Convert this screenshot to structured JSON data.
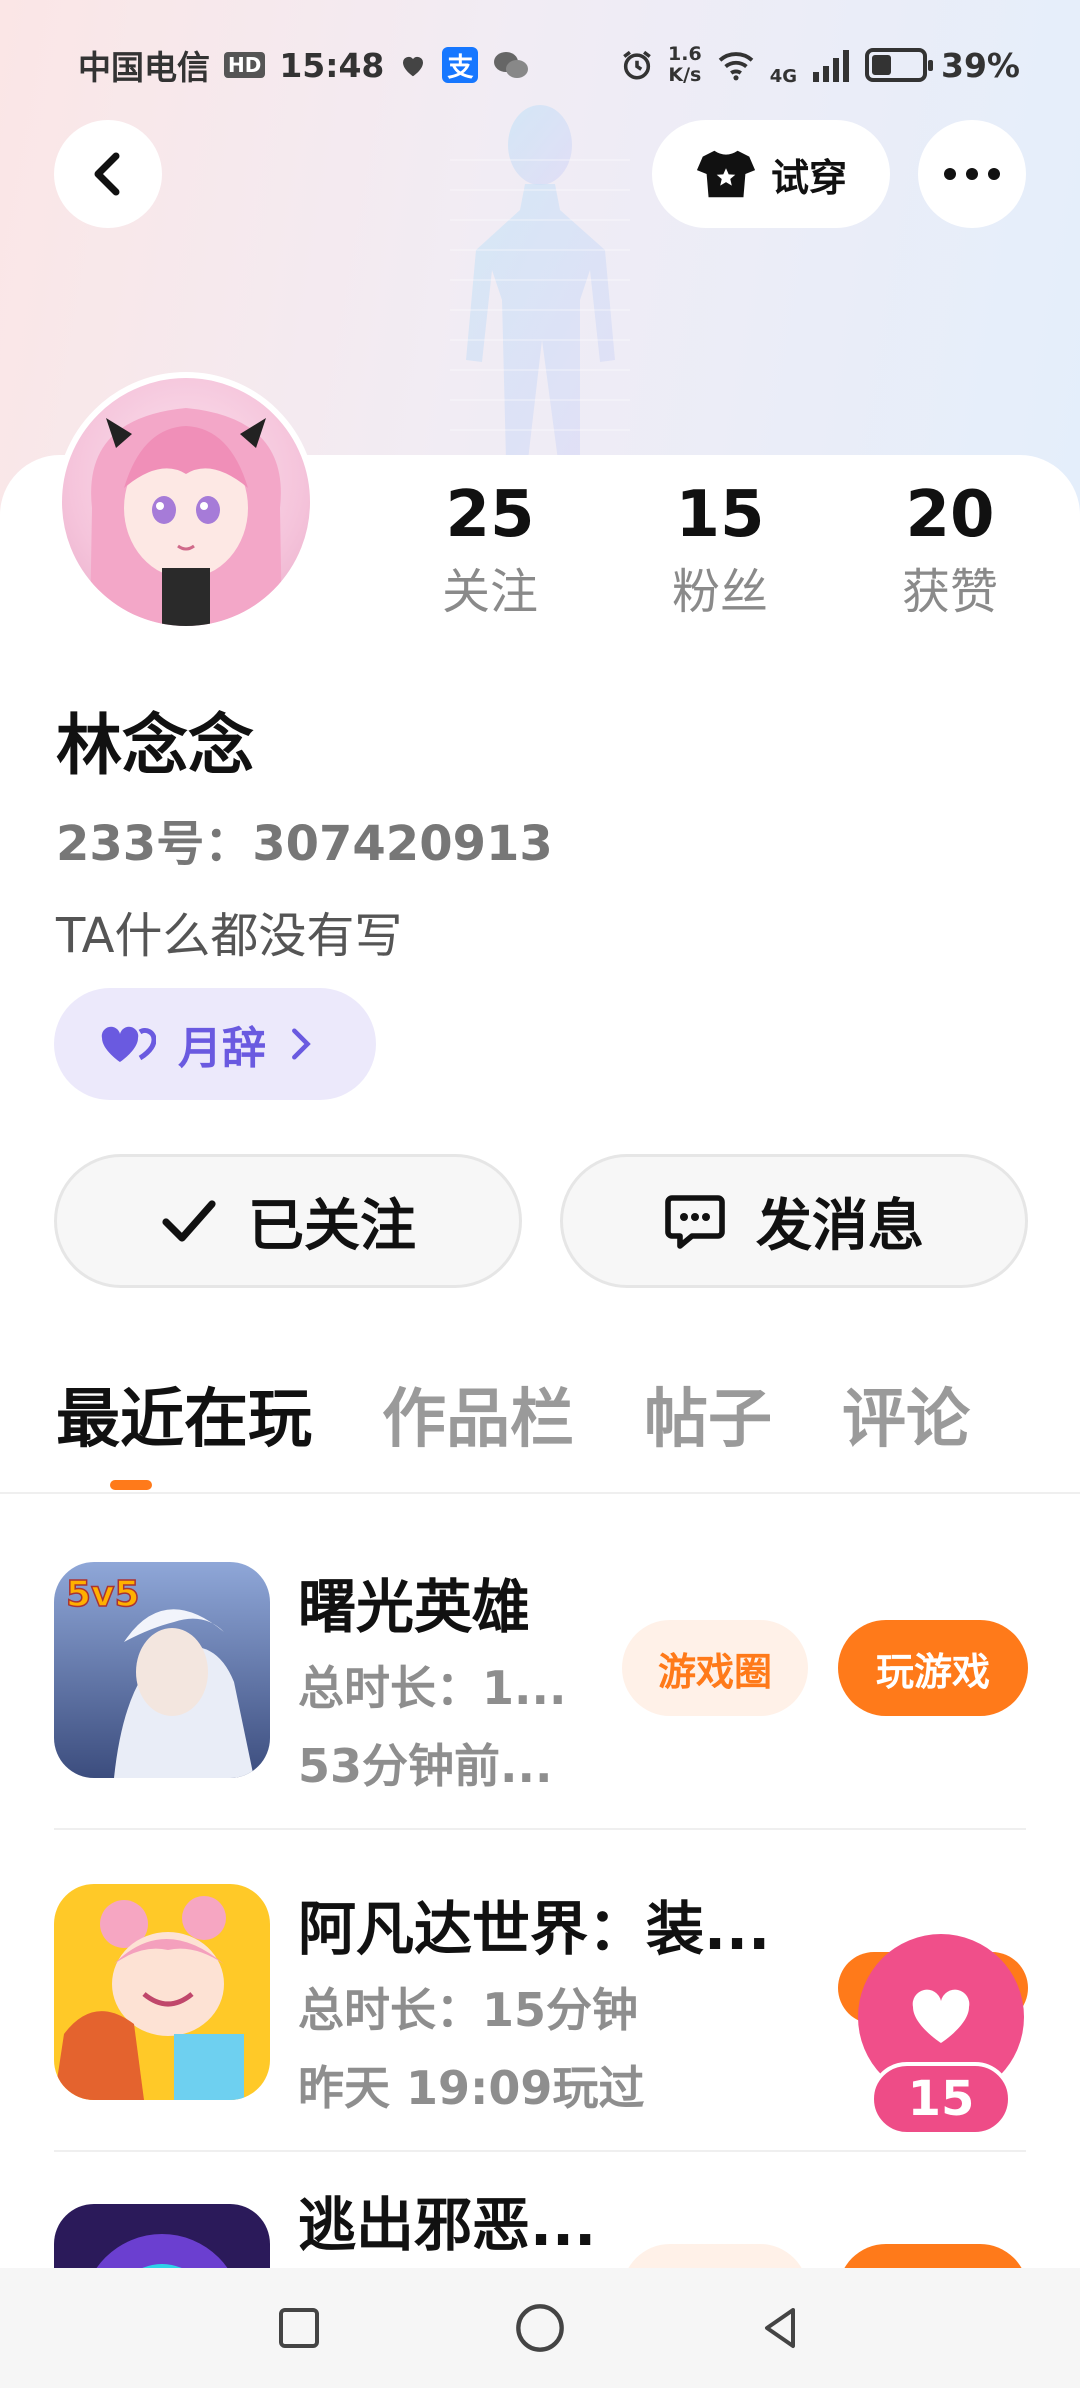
{
  "status_bar": {
    "carrier": "中国电信",
    "hd": "HD",
    "time": "15:48",
    "alipay": "支",
    "net_speed_value": "1.6",
    "net_speed_unit": "K/s",
    "network": "4G",
    "battery_percent": "39%",
    "battery_level": 0.39
  },
  "header": {
    "try_on_label": "试穿"
  },
  "profile": {
    "stats": [
      {
        "value": "25",
        "label": "关注"
      },
      {
        "value": "15",
        "label": "粉丝"
      },
      {
        "value": "20",
        "label": "获赞"
      }
    ],
    "name": "林念念",
    "id_text": "233号：307420913",
    "bio": "TA什么都没有写",
    "badge_label": "月辞"
  },
  "actions": {
    "follow_label": "已关注",
    "message_label": "发消息"
  },
  "tabs": [
    {
      "label": "最近在玩",
      "active": true
    },
    {
      "label": "作品栏",
      "active": false
    },
    {
      "label": "帖子",
      "active": false
    },
    {
      "label": "评论",
      "active": false
    }
  ],
  "games": [
    {
      "title": "曙光英雄",
      "meta1": "总时长：1...",
      "meta2": "53分钟前...",
      "circle_label": "游戏圈",
      "play_label": "玩游戏",
      "icon_badge": "5v5"
    },
    {
      "title": "阿凡达世界：装...",
      "meta1": "总时长：15分钟",
      "meta2": "昨天 19:09玩过"
    },
    {
      "title": "逃出邪恶..."
    }
  ],
  "like_float": {
    "count": "15"
  },
  "colors": {
    "accent": "#ff7a1a",
    "like_pink": "#f04f8a",
    "badge_purple": "#6a5ae0"
  }
}
